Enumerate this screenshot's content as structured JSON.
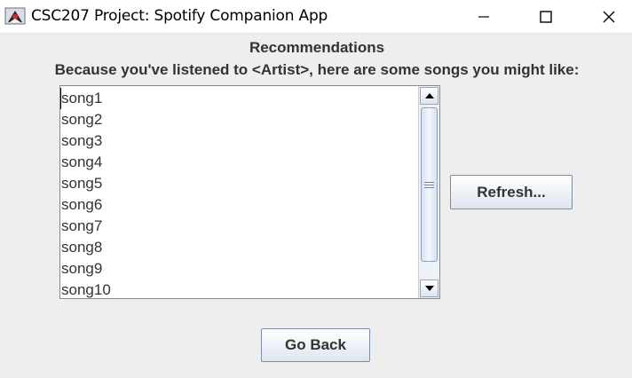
{
  "window": {
    "title": "CSC207 Project: Spotify Companion App",
    "app_icon": "java-duke-icon",
    "controls": [
      "minimize-icon",
      "maximize-icon",
      "close-icon"
    ]
  },
  "header": {
    "title": "Recommendations",
    "subtitle": "Because you've listened to <Artist>, here are some songs you might like:"
  },
  "songs": [
    "song1",
    "song2",
    "song3",
    "song4",
    "song5",
    "song6",
    "song7",
    "song8",
    "song9",
    "song10"
  ],
  "buttons": {
    "refresh": "Refresh...",
    "back": "Go Back"
  },
  "colors": {
    "background": "#eeeeee",
    "text": "#333333",
    "button_gradient_top": "#ffffff",
    "button_gradient_bottom": "#dde5f0"
  }
}
